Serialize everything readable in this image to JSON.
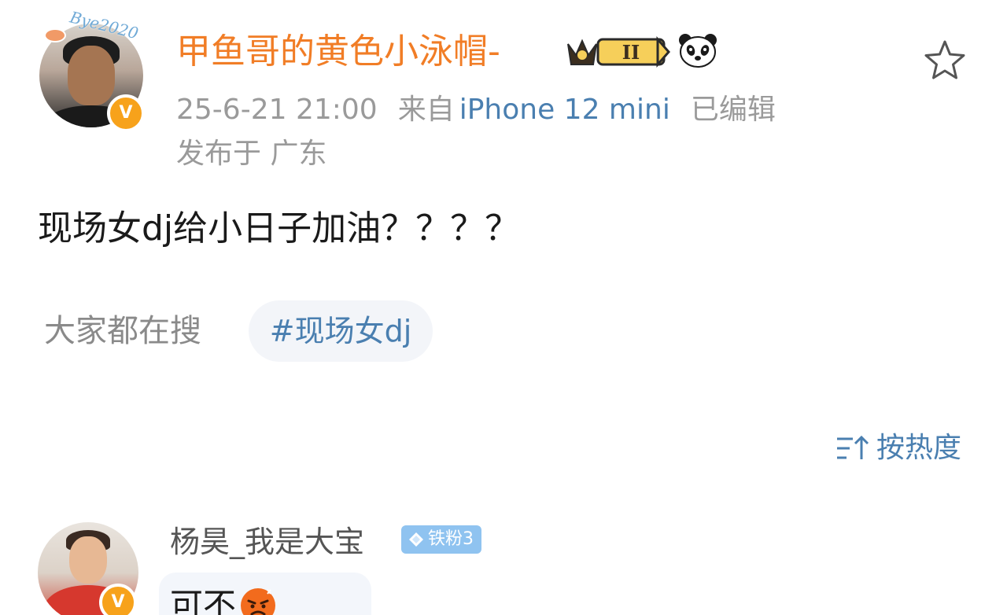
{
  "post": {
    "author": {
      "name": "甲鱼哥的黄色小泳帽-",
      "avatar_text": "Bye2020",
      "verified_mark": "V",
      "level_badge": "II"
    },
    "timestamp": "25-6-21 21:00",
    "source_prefix": "来自",
    "device": "iPhone 12 mini",
    "edited": "已编辑",
    "location": "发布于 广东",
    "text": "现场女dj给小日子加油？？？？",
    "everyone_searching_label": "大家都在搜",
    "hashtag": "#现场女dj",
    "icons": {
      "favorite": "star-icon",
      "crown": "crown-badge-icon",
      "panda": "panda-icon"
    }
  },
  "comments_header": {
    "sort_label": "按热度",
    "sort_icon": "sort-icon"
  },
  "comment": {
    "author": "杨昊_我是大宝",
    "verified_mark": "V",
    "fan_badge": "铁粉3",
    "text": "可不",
    "emoji": "angry-emoji"
  },
  "colors": {
    "username": "#f17d26",
    "link": "#4a7fb0",
    "meta": "#9a9a9a",
    "verified": "#f7a21b",
    "fan_badge": "#8fc3f0"
  }
}
